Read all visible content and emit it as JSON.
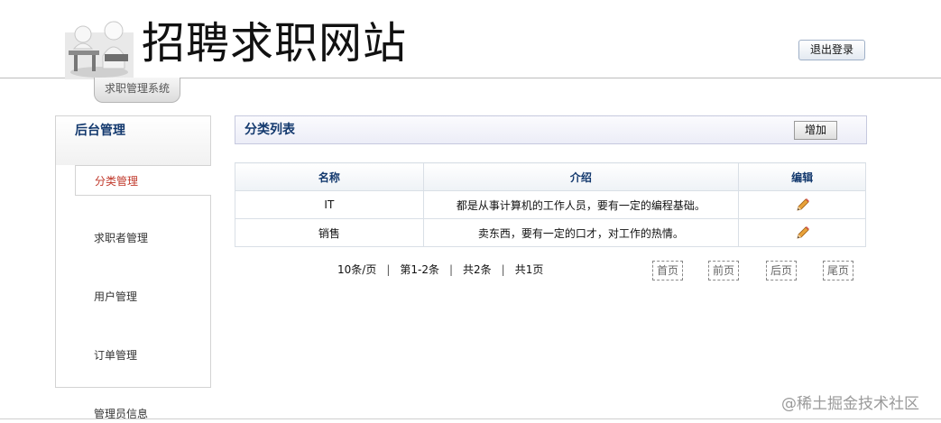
{
  "header": {
    "site_title": "招聘求职网站",
    "subsystem_label": "求职管理系统",
    "logout_label": "退出登录"
  },
  "sidebar": {
    "title": "后台管理",
    "items": [
      {
        "label": "分类管理",
        "active": true
      },
      {
        "label": "求职者管理",
        "active": false
      },
      {
        "label": "用户管理",
        "active": false
      },
      {
        "label": "订单管理",
        "active": false
      },
      {
        "label": "管理员信息",
        "active": false
      }
    ]
  },
  "main": {
    "panel_title": "分类列表",
    "add_label": "增加",
    "table": {
      "headers": [
        "名称",
        "介绍",
        "编辑"
      ],
      "rows": [
        {
          "name": "IT",
          "intro": "都是从事计算机的工作人员，要有一定的编程基础。",
          "edit_icon": "pencil-icon"
        },
        {
          "name": "销售",
          "intro": "卖东西，要有一定的口才，对工作的热情。",
          "edit_icon": "pencil-icon"
        }
      ]
    },
    "pager": {
      "per_page": "10条/页",
      "range": "第1-2条",
      "total": "共2条",
      "pages": "共1页",
      "separator": "|",
      "first": "首页",
      "prev": "前页",
      "next": "后页",
      "last": "尾页"
    }
  },
  "watermark": "@稀土掘金技术社区",
  "colors": {
    "heading_blue": "#13396e",
    "active_red": "#c0392b"
  }
}
